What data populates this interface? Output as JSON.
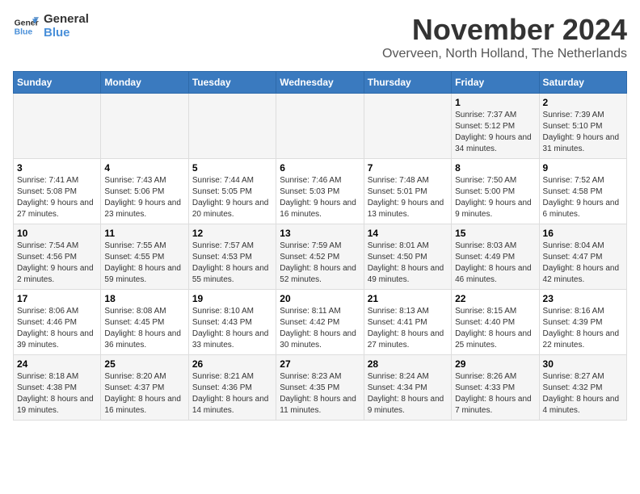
{
  "header": {
    "logo_line1": "General",
    "logo_line2": "Blue",
    "month": "November 2024",
    "location": "Overveen, North Holland, The Netherlands"
  },
  "weekdays": [
    "Sunday",
    "Monday",
    "Tuesday",
    "Wednesday",
    "Thursday",
    "Friday",
    "Saturday"
  ],
  "weeks": [
    [
      {
        "day": "",
        "sunrise": "",
        "sunset": "",
        "daylight": ""
      },
      {
        "day": "",
        "sunrise": "",
        "sunset": "",
        "daylight": ""
      },
      {
        "day": "",
        "sunrise": "",
        "sunset": "",
        "daylight": ""
      },
      {
        "day": "",
        "sunrise": "",
        "sunset": "",
        "daylight": ""
      },
      {
        "day": "",
        "sunrise": "",
        "sunset": "",
        "daylight": ""
      },
      {
        "day": "1",
        "sunrise": "Sunrise: 7:37 AM",
        "sunset": "Sunset: 5:12 PM",
        "daylight": "Daylight: 9 hours and 34 minutes."
      },
      {
        "day": "2",
        "sunrise": "Sunrise: 7:39 AM",
        "sunset": "Sunset: 5:10 PM",
        "daylight": "Daylight: 9 hours and 31 minutes."
      }
    ],
    [
      {
        "day": "3",
        "sunrise": "Sunrise: 7:41 AM",
        "sunset": "Sunset: 5:08 PM",
        "daylight": "Daylight: 9 hours and 27 minutes."
      },
      {
        "day": "4",
        "sunrise": "Sunrise: 7:43 AM",
        "sunset": "Sunset: 5:06 PM",
        "daylight": "Daylight: 9 hours and 23 minutes."
      },
      {
        "day": "5",
        "sunrise": "Sunrise: 7:44 AM",
        "sunset": "Sunset: 5:05 PM",
        "daylight": "Daylight: 9 hours and 20 minutes."
      },
      {
        "day": "6",
        "sunrise": "Sunrise: 7:46 AM",
        "sunset": "Sunset: 5:03 PM",
        "daylight": "Daylight: 9 hours and 16 minutes."
      },
      {
        "day": "7",
        "sunrise": "Sunrise: 7:48 AM",
        "sunset": "Sunset: 5:01 PM",
        "daylight": "Daylight: 9 hours and 13 minutes."
      },
      {
        "day": "8",
        "sunrise": "Sunrise: 7:50 AM",
        "sunset": "Sunset: 5:00 PM",
        "daylight": "Daylight: 9 hours and 9 minutes."
      },
      {
        "day": "9",
        "sunrise": "Sunrise: 7:52 AM",
        "sunset": "Sunset: 4:58 PM",
        "daylight": "Daylight: 9 hours and 6 minutes."
      }
    ],
    [
      {
        "day": "10",
        "sunrise": "Sunrise: 7:54 AM",
        "sunset": "Sunset: 4:56 PM",
        "daylight": "Daylight: 9 hours and 2 minutes."
      },
      {
        "day": "11",
        "sunrise": "Sunrise: 7:55 AM",
        "sunset": "Sunset: 4:55 PM",
        "daylight": "Daylight: 8 hours and 59 minutes."
      },
      {
        "day": "12",
        "sunrise": "Sunrise: 7:57 AM",
        "sunset": "Sunset: 4:53 PM",
        "daylight": "Daylight: 8 hours and 55 minutes."
      },
      {
        "day": "13",
        "sunrise": "Sunrise: 7:59 AM",
        "sunset": "Sunset: 4:52 PM",
        "daylight": "Daylight: 8 hours and 52 minutes."
      },
      {
        "day": "14",
        "sunrise": "Sunrise: 8:01 AM",
        "sunset": "Sunset: 4:50 PM",
        "daylight": "Daylight: 8 hours and 49 minutes."
      },
      {
        "day": "15",
        "sunrise": "Sunrise: 8:03 AM",
        "sunset": "Sunset: 4:49 PM",
        "daylight": "Daylight: 8 hours and 46 minutes."
      },
      {
        "day": "16",
        "sunrise": "Sunrise: 8:04 AM",
        "sunset": "Sunset: 4:47 PM",
        "daylight": "Daylight: 8 hours and 42 minutes."
      }
    ],
    [
      {
        "day": "17",
        "sunrise": "Sunrise: 8:06 AM",
        "sunset": "Sunset: 4:46 PM",
        "daylight": "Daylight: 8 hours and 39 minutes."
      },
      {
        "day": "18",
        "sunrise": "Sunrise: 8:08 AM",
        "sunset": "Sunset: 4:45 PM",
        "daylight": "Daylight: 8 hours and 36 minutes."
      },
      {
        "day": "19",
        "sunrise": "Sunrise: 8:10 AM",
        "sunset": "Sunset: 4:43 PM",
        "daylight": "Daylight: 8 hours and 33 minutes."
      },
      {
        "day": "20",
        "sunrise": "Sunrise: 8:11 AM",
        "sunset": "Sunset: 4:42 PM",
        "daylight": "Daylight: 8 hours and 30 minutes."
      },
      {
        "day": "21",
        "sunrise": "Sunrise: 8:13 AM",
        "sunset": "Sunset: 4:41 PM",
        "daylight": "Daylight: 8 hours and 27 minutes."
      },
      {
        "day": "22",
        "sunrise": "Sunrise: 8:15 AM",
        "sunset": "Sunset: 4:40 PM",
        "daylight": "Daylight: 8 hours and 25 minutes."
      },
      {
        "day": "23",
        "sunrise": "Sunrise: 8:16 AM",
        "sunset": "Sunset: 4:39 PM",
        "daylight": "Daylight: 8 hours and 22 minutes."
      }
    ],
    [
      {
        "day": "24",
        "sunrise": "Sunrise: 8:18 AM",
        "sunset": "Sunset: 4:38 PM",
        "daylight": "Daylight: 8 hours and 19 minutes."
      },
      {
        "day": "25",
        "sunrise": "Sunrise: 8:20 AM",
        "sunset": "Sunset: 4:37 PM",
        "daylight": "Daylight: 8 hours and 16 minutes."
      },
      {
        "day": "26",
        "sunrise": "Sunrise: 8:21 AM",
        "sunset": "Sunset: 4:36 PM",
        "daylight": "Daylight: 8 hours and 14 minutes."
      },
      {
        "day": "27",
        "sunrise": "Sunrise: 8:23 AM",
        "sunset": "Sunset: 4:35 PM",
        "daylight": "Daylight: 8 hours and 11 minutes."
      },
      {
        "day": "28",
        "sunrise": "Sunrise: 8:24 AM",
        "sunset": "Sunset: 4:34 PM",
        "daylight": "Daylight: 8 hours and 9 minutes."
      },
      {
        "day": "29",
        "sunrise": "Sunrise: 8:26 AM",
        "sunset": "Sunset: 4:33 PM",
        "daylight": "Daylight: 8 hours and 7 minutes."
      },
      {
        "day": "30",
        "sunrise": "Sunrise: 8:27 AM",
        "sunset": "Sunset: 4:32 PM",
        "daylight": "Daylight: 8 hours and 4 minutes."
      }
    ]
  ]
}
